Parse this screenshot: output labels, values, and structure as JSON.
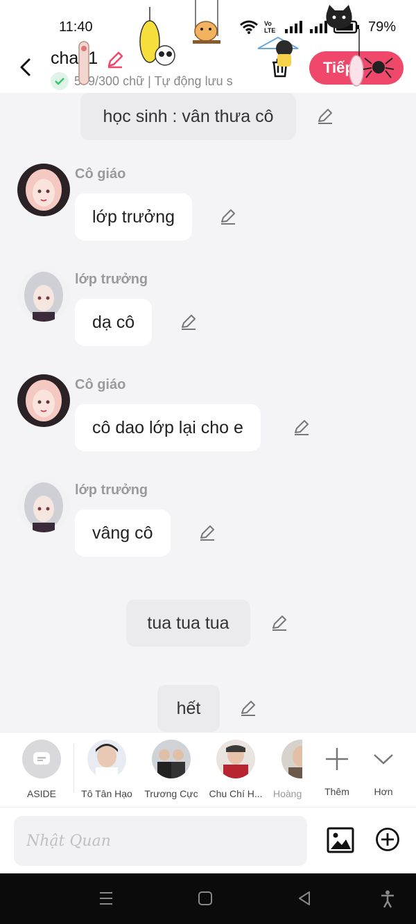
{
  "status_bar": {
    "time": "11:40",
    "battery": "79%",
    "carrier_tag": "Vo LTE"
  },
  "header": {
    "title": "chap1",
    "subtitle": "579/300 chữ | Tự động lưu s",
    "next_label": "Tiếp"
  },
  "messages": [
    {
      "type": "narration",
      "text": "học sinh : vân thưa cô"
    },
    {
      "type": "dialogue",
      "speaker": "Cô giáo",
      "text": "lớp trưởng",
      "avatar": "teacher"
    },
    {
      "type": "dialogue",
      "speaker": "lớp trưởng",
      "text": "dạ cô",
      "avatar": "monitor"
    },
    {
      "type": "dialogue",
      "speaker": "Cô giáo",
      "text": "cô dao lớp lại cho e",
      "avatar": "teacher"
    },
    {
      "type": "dialogue",
      "speaker": "lớp trưởng",
      "text": "vâng cô",
      "avatar": "monitor"
    },
    {
      "type": "narration",
      "text": "tua tua tua"
    },
    {
      "type": "narration",
      "text": "hết"
    }
  ],
  "characters": [
    {
      "label": "ASIDE"
    },
    {
      "label": "Tô Tân Hạo"
    },
    {
      "label": "Trương Cực"
    },
    {
      "label": "Chu Chí H..."
    },
    {
      "label": "Hoàng"
    },
    {
      "label": "Thêm"
    },
    {
      "label": "Hơn"
    }
  ],
  "input": {
    "placeholder": "Nhật Quan"
  },
  "colors": {
    "accent": "#f0486a",
    "bubble": "#ffffff",
    "narration": "#ebebed",
    "background": "#f4f4f6"
  }
}
